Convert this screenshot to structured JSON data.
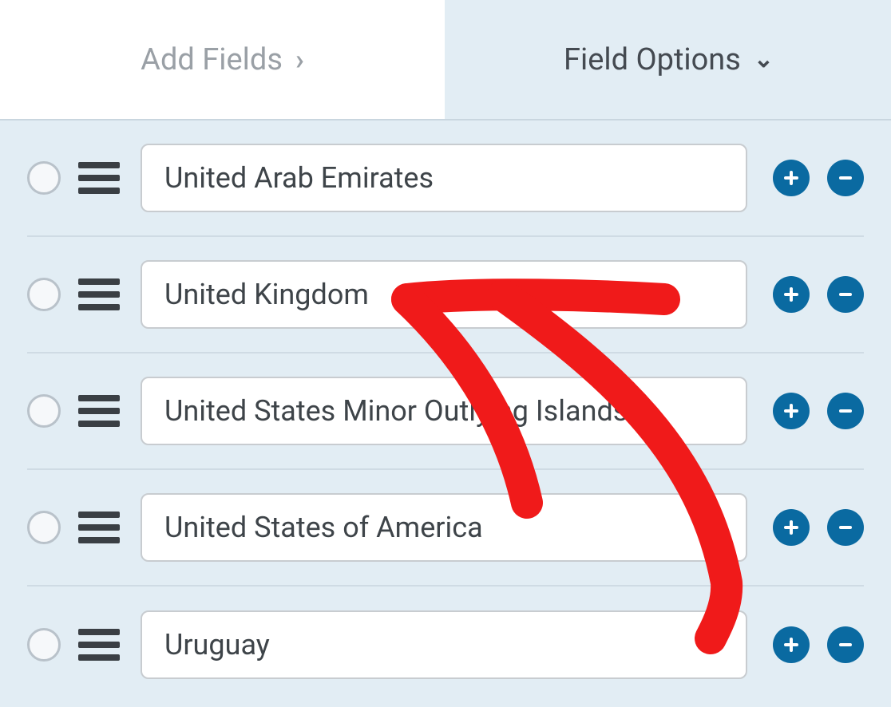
{
  "tabs": {
    "add_fields_label": "Add Fields",
    "field_options_label": "Field Options"
  },
  "options": [
    {
      "value": "United Arab Emirates"
    },
    {
      "value": "United Kingdom"
    },
    {
      "value": "United States Minor Outlying Islands"
    },
    {
      "value": "United States of America"
    },
    {
      "value": "Uruguay"
    }
  ]
}
